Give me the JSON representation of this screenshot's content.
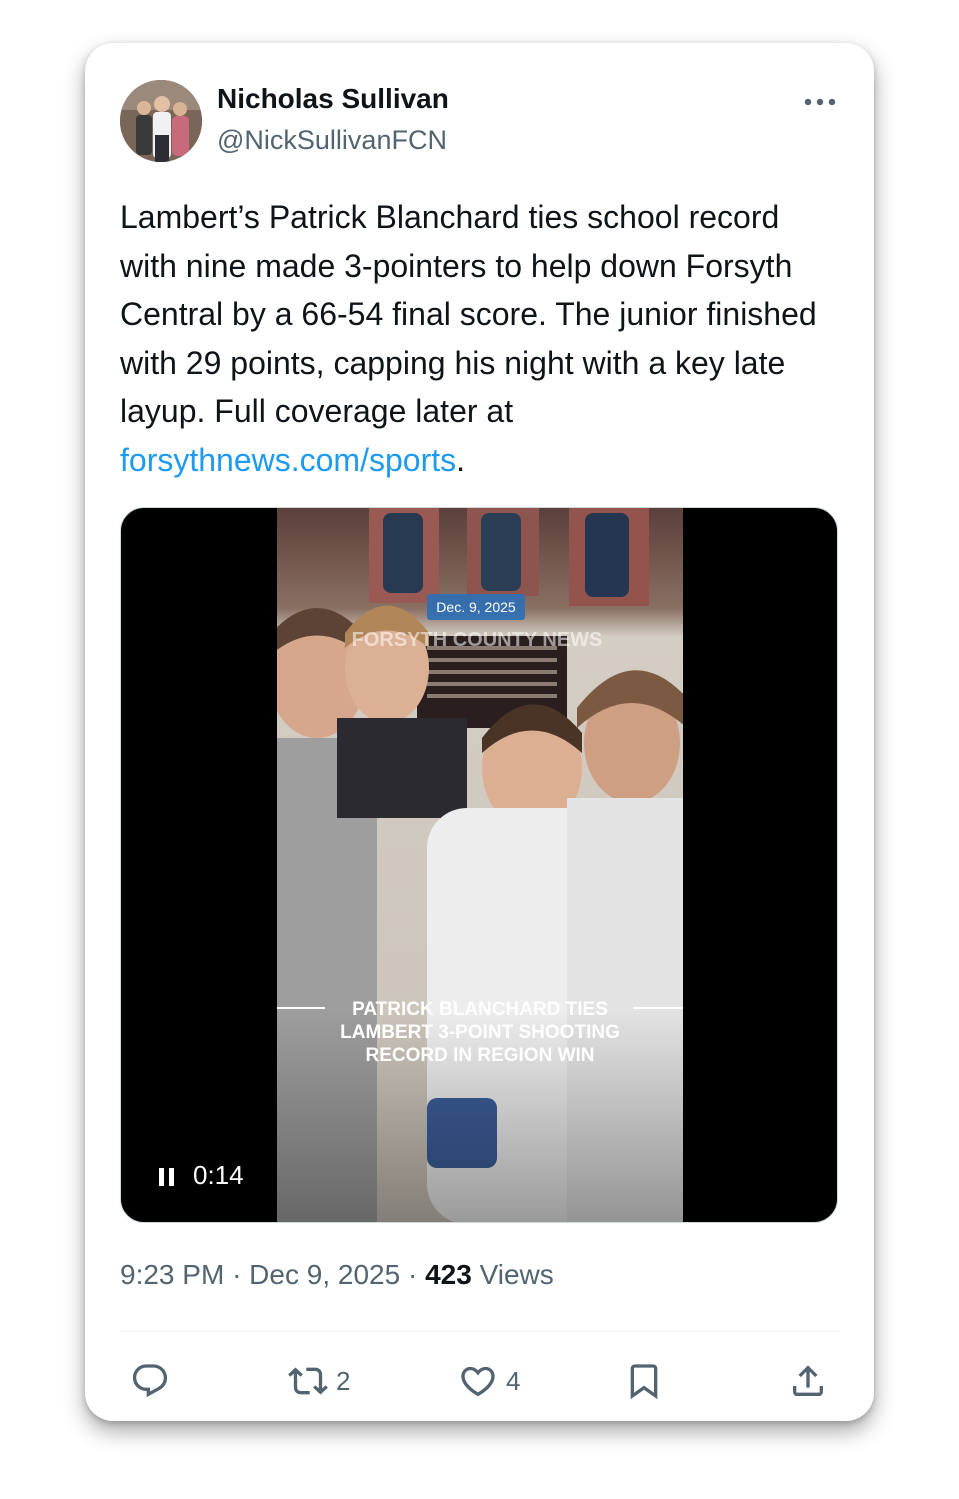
{
  "tweet": {
    "author": {
      "display_name": "Nicholas Sullivan",
      "handle": "@NickSullivanFCN"
    },
    "text_parts": {
      "before_link": "Lambert’s Patrick Blanchard ties school record with nine made 3-pointers to help down Forsyth Central by a 66-54 final score. The junior finished with 29 points, capping his night with a key late layup. Full coverage later at ",
      "link": "forsythnews.com/sports",
      "after_link": "."
    },
    "video": {
      "date_badge": "Dec. 9, 2025",
      "watermark": "FORSYTH COUNTY NEWS",
      "caption_lines": [
        "PATRICK BLANCHARD TIES",
        "LAMBERT 3-POINT SHOOTING",
        "RECORD IN REGION WIN"
      ],
      "elapsed": "0:14",
      "state": "playing"
    },
    "meta": {
      "time": "9:23 PM",
      "separator": "·",
      "date": "Dec 9, 2025",
      "views_count": "423",
      "views_label": "Views"
    },
    "actions": {
      "reply_count": "",
      "retweet_count": "2",
      "like_count": "4"
    }
  },
  "colors": {
    "text_primary": "#0f1419",
    "text_secondary": "#536471",
    "link": "#1d9bf0",
    "date_badge": "#2f6fb3"
  },
  "icons": {
    "more": "more-horizontal-icon",
    "pause": "pause-icon",
    "reply": "reply-icon",
    "retweet": "retweet-icon",
    "like": "heart-icon",
    "bookmark": "bookmark-icon",
    "share": "share-icon"
  }
}
